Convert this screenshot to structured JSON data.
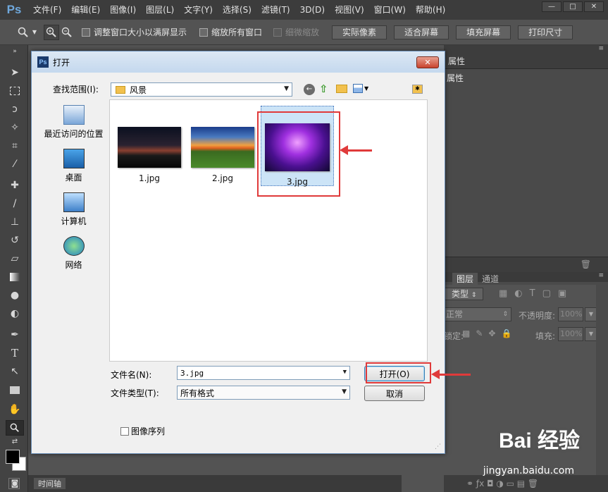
{
  "app": {
    "logo": "Ps"
  },
  "menubar": {
    "items": [
      "文件(F)",
      "编辑(E)",
      "图像(I)",
      "图层(L)",
      "文字(Y)",
      "选择(S)",
      "滤镜(T)",
      "3D(D)",
      "视图(V)",
      "窗口(W)",
      "帮助(H)"
    ],
    "window_controls": {
      "minimize": "—",
      "restore": "□",
      "close": "✕"
    }
  },
  "options_bar": {
    "checks": [
      {
        "label": "调整窗口大小以满屏显示",
        "disabled": false
      },
      {
        "label": "缩放所有窗口",
        "disabled": false
      },
      {
        "label": "细微缩放",
        "disabled": true
      }
    ],
    "buttons": [
      "实际像素",
      "适合屏幕",
      "填充屏幕",
      "打印尺寸"
    ]
  },
  "right_panel": {
    "attr_tab": "属性",
    "attr_title": "属性",
    "layers_tabs": [
      "图层",
      "通道"
    ],
    "kind_label": "类型",
    "blend_mode": "正常",
    "opacity_label": "不透明度:",
    "opacity_value": "100%",
    "lock_label": "锁定:",
    "fill_label": "填充:",
    "fill_value": "100%"
  },
  "timeline": {
    "label": "时间轴"
  },
  "dialog": {
    "title": "打开",
    "title_icon": "Ps",
    "look_in_label": "查找范围(I):",
    "look_in_value": "风景",
    "places": [
      "最近访问的位置",
      "桌面",
      "计算机",
      "网络"
    ],
    "files": [
      {
        "name": "1.jpg",
        "selected": false
      },
      {
        "name": "2.jpg",
        "selected": false
      },
      {
        "name": "3.jpg",
        "selected": true
      }
    ],
    "filename_label": "文件名(N):",
    "filename_value": "3.jpg",
    "filetype_label": "文件类型(T):",
    "filetype_value": "所有格式",
    "open_button": "打开(O)",
    "cancel_button": "取消",
    "image_sequence_label": "图像序列"
  },
  "watermark": {
    "brand": "Bai 经验",
    "url": "jingyan.baidu.com"
  },
  "colors": {
    "accent_red": "#e03a3a",
    "selection": "#cce4f7"
  }
}
